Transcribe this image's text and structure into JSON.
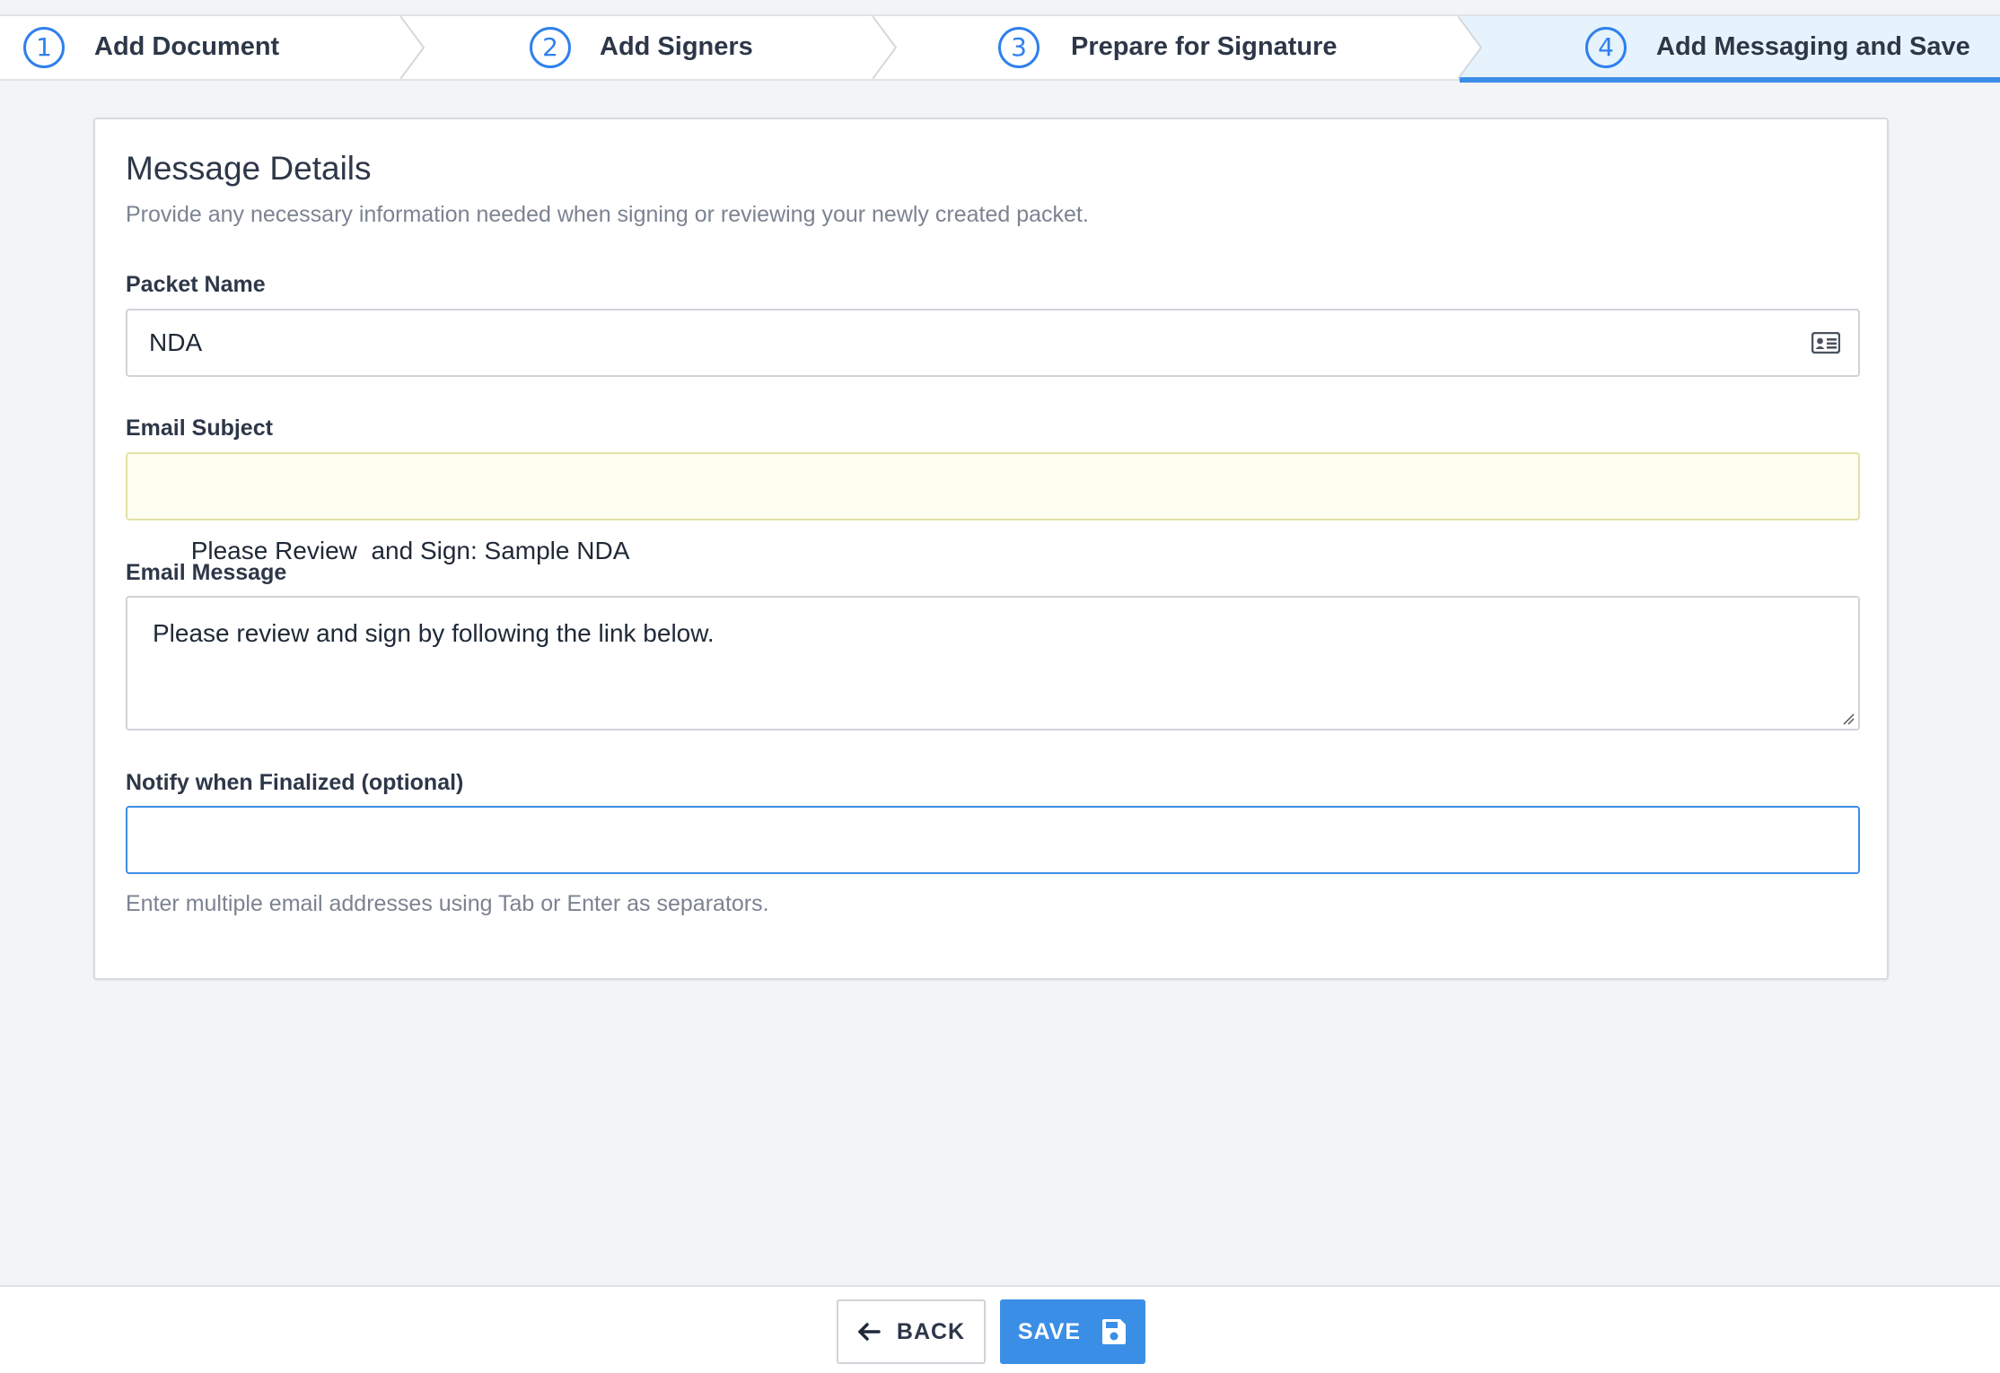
{
  "stepper": {
    "steps": [
      {
        "number": "1",
        "label": "Add Document"
      },
      {
        "number": "2",
        "label": "Add Signers"
      },
      {
        "number": "3",
        "label": "Prepare for Signature"
      },
      {
        "number": "4",
        "label": "Add Messaging and Save"
      }
    ],
    "active_step": 4
  },
  "card": {
    "title": "Message Details",
    "subtitle": "Provide any necessary information needed when signing or reviewing your newly created packet."
  },
  "form": {
    "packet_name": {
      "label": "Packet Name",
      "value": "NDA",
      "icon": "id-card-icon"
    },
    "email_subject": {
      "label": "Email Subject",
      "value": "Please Review  and Sign: Sample NDA"
    },
    "email_message": {
      "label": "Email Message",
      "value": "Please review and sign by following the link below."
    },
    "notify": {
      "label": "Notify when Finalized (optional)",
      "value": "",
      "help": "Enter multiple email addresses using Tab or Enter as separators."
    }
  },
  "footer": {
    "back_label": "BACK",
    "save_label": "SAVE"
  },
  "colors": {
    "accent": "#3b8ee6",
    "active_step_bg": "#e6f3fc",
    "highlight_field_bg": "#fefef1"
  }
}
